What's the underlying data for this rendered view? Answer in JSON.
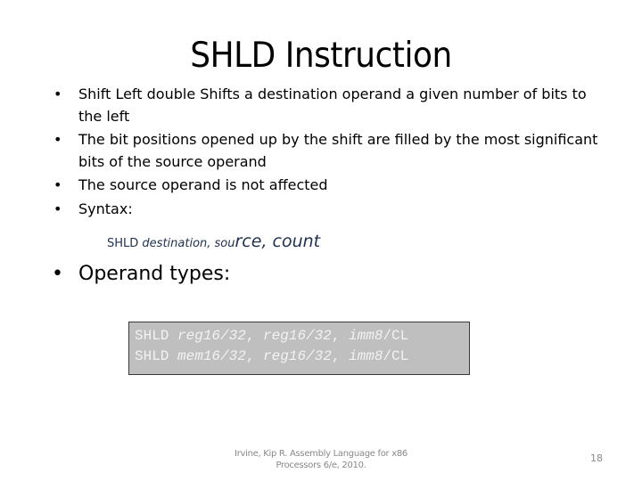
{
  "slide": {
    "title": "SHLD Instruction",
    "bullets": [
      "Shift Left double Shifts a destination operand a given number of bits to the left",
      "The bit positions opened up by the shift are filled by the most significant bits of the source operand",
      "The source operand is not affected",
      "Syntax:"
    ],
    "bullet_glyph": "•",
    "syntax": {
      "mnemonic": "SHLD ",
      "args_small": "destination, sou",
      "args_large": "rce, count"
    },
    "operand_heading": "Operand types:",
    "code_lines": [
      {
        "op": "SHLD ",
        "a": "reg16/32",
        "sep1": ", ",
        "b": "reg16/32",
        "sep2": ", ",
        "c": "imm8",
        "tail": "/CL"
      },
      {
        "op": "SHLD ",
        "a": "mem16/32",
        "sep1": ", ",
        "b": "reg16/32",
        "sep2": ", ",
        "c": "imm8",
        "tail": "/CL"
      }
    ],
    "footer": {
      "citation_line1": "Irvine, Kip R. Assembly Language for x86",
      "citation_line2": "Processors 6/e, 2010.",
      "page_number": "18"
    }
  }
}
